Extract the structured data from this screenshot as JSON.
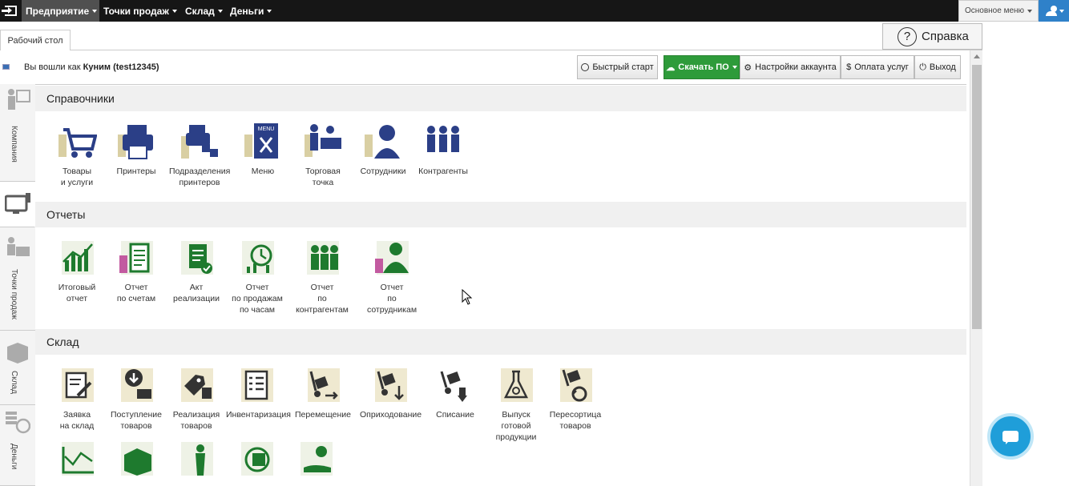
{
  "topnav": {
    "menus": [
      {
        "label": "Предприятие",
        "active": true
      },
      {
        "label": "Точки продаж",
        "active": false
      },
      {
        "label": "Склад",
        "active": false
      },
      {
        "label": "Деньги",
        "active": false
      }
    ],
    "main_menu": "Основное меню"
  },
  "tabs": {
    "active": "Рабочий стол"
  },
  "help": {
    "label": "Справка"
  },
  "account": {
    "prefix": "Вы вошли как",
    "user": "Куним (test12345)"
  },
  "toolbar": {
    "quick_start": "Быстрый старт",
    "download": "Скачать ПО",
    "settings": "Настройки аккаунта",
    "payment": "Оплата услуг",
    "logout": "Выход"
  },
  "sidebar": [
    "Компания",
    "Точки продаж",
    "Склад",
    "Деньги"
  ],
  "sections": {
    "directories": {
      "title": "Справочники",
      "items": [
        "Товары\nи услуги",
        "Принтеры",
        "Подразделения\nпринтеров",
        "Меню",
        "Торговая\nточка",
        "Сотрудники",
        "Контрагенты"
      ]
    },
    "reports": {
      "title": "Отчеты",
      "items": [
        "Итоговый\nотчет",
        "Отчет\nпо счетам",
        "Акт\nреализации",
        "Отчет\nпо продажам\nпо часам",
        "Отчет\nпо контрагентам",
        "Отчет\nпо сотрудникам"
      ]
    },
    "warehouse": {
      "title": "Склад",
      "items": [
        "Заявка\nна склад",
        "Поступление\nтоваров",
        "Реализация\nтоваров",
        "Инвентаризация",
        "Перемещение",
        "Оприходование",
        "Списание",
        "Выпуск\nготовой\nпродукции",
        "Пересортица\nтоваров"
      ]
    }
  },
  "colors": {
    "accent": "#2f81c9",
    "green": "#2e9b3a",
    "icon_blue": "#2b3f87",
    "icon_green": "#1e7a2e",
    "icon_dark": "#3a3a3a"
  }
}
